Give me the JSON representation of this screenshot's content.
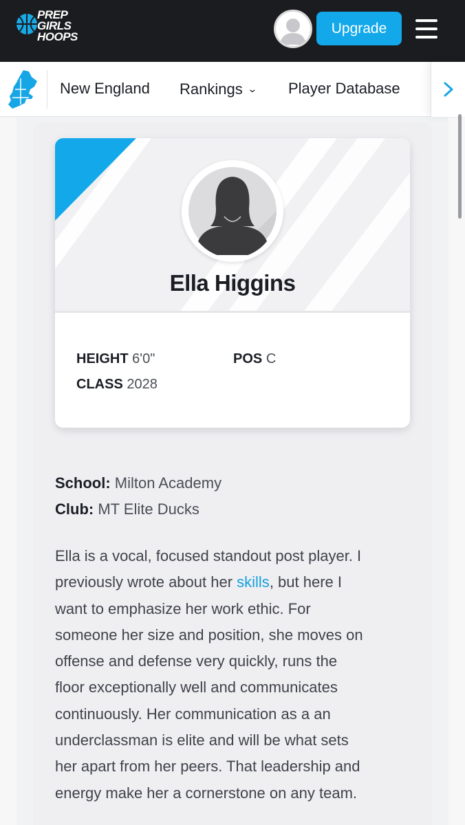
{
  "header": {
    "logo_lines": [
      "PREP",
      "GIRLS",
      "HOOPS"
    ],
    "upgrade_label": "Upgrade",
    "menu_icon": "hamburger-menu-icon",
    "avatar_icon": "user-avatar-icon"
  },
  "nav": {
    "region_icon": "new-england-map-icon",
    "items": [
      {
        "label": "New England"
      },
      {
        "label": "Rankings",
        "has_dropdown": true
      },
      {
        "label": "Player Database"
      }
    ],
    "next_icon": "chevron-right-icon"
  },
  "player": {
    "name": "Ella Higgins",
    "height_label": "HEIGHT",
    "height_value": "6'0\"",
    "pos_label": "POS",
    "pos_value": "C",
    "class_label": "CLASS",
    "class_value": "2028",
    "school_label": "School:",
    "school_value": "Milton Academy",
    "club_label": "Club:",
    "club_value": "MT Elite Ducks"
  },
  "bio": {
    "line1": "Ella is a vocal, focused standout post player. I",
    "line2_pre": "previously wrote about her ",
    "line2_link": "skills",
    "line2_post": ", but here I",
    "line3": "want to emphasize her work ethic. For",
    "line4": "someone her size and position, she moves on",
    "line5": "offense and defense very quickly, runs the",
    "line6": "floor exceptionally well and communicates",
    "line7": "continuously. Her communication as a an",
    "line8": "underclassman is elite and will be what sets",
    "line9": "her apart from her peers. That leadership and",
    "line10": "energy make her a cornerstone on any team."
  },
  "colors": {
    "accent": "#12a8ea",
    "header_bg": "#1b1c1f",
    "link": "#14a0dc"
  }
}
